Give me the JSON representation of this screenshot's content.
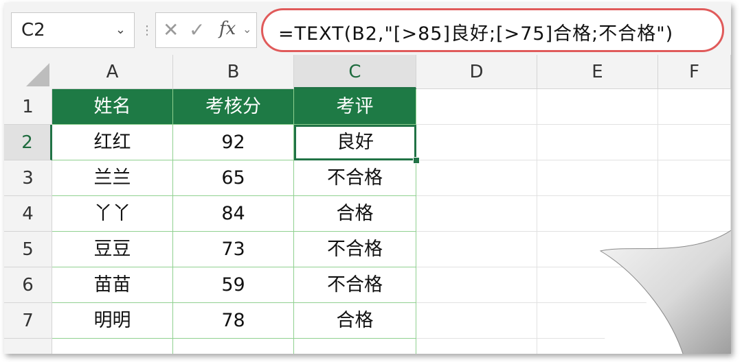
{
  "formula_bar": {
    "name_box": "C2",
    "cancel_icon": "✕",
    "enter_icon": "✓",
    "fx_label": "fx",
    "formula": "=TEXT(B2,\"[>85]良好;[>75]合格;不合格\")"
  },
  "columns": [
    "A",
    "B",
    "C",
    "D",
    "E",
    "F"
  ],
  "rows": [
    "1",
    "2",
    "3",
    "4",
    "5",
    "6",
    "7"
  ],
  "table": {
    "headers": [
      "姓名",
      "考核分",
      "考评"
    ],
    "data": [
      [
        "红红",
        "92",
        "良好"
      ],
      [
        "兰兰",
        "65",
        "不合格"
      ],
      [
        "丫丫",
        "84",
        "合格"
      ],
      [
        "豆豆",
        "73",
        "不合格"
      ],
      [
        "苗苗",
        "59",
        "不合格"
      ],
      [
        "明明",
        "78",
        "合格"
      ]
    ]
  },
  "colors": {
    "header_fill": "#1e7a45",
    "highlight_border": "#e05a5a",
    "selection": "#217346"
  }
}
